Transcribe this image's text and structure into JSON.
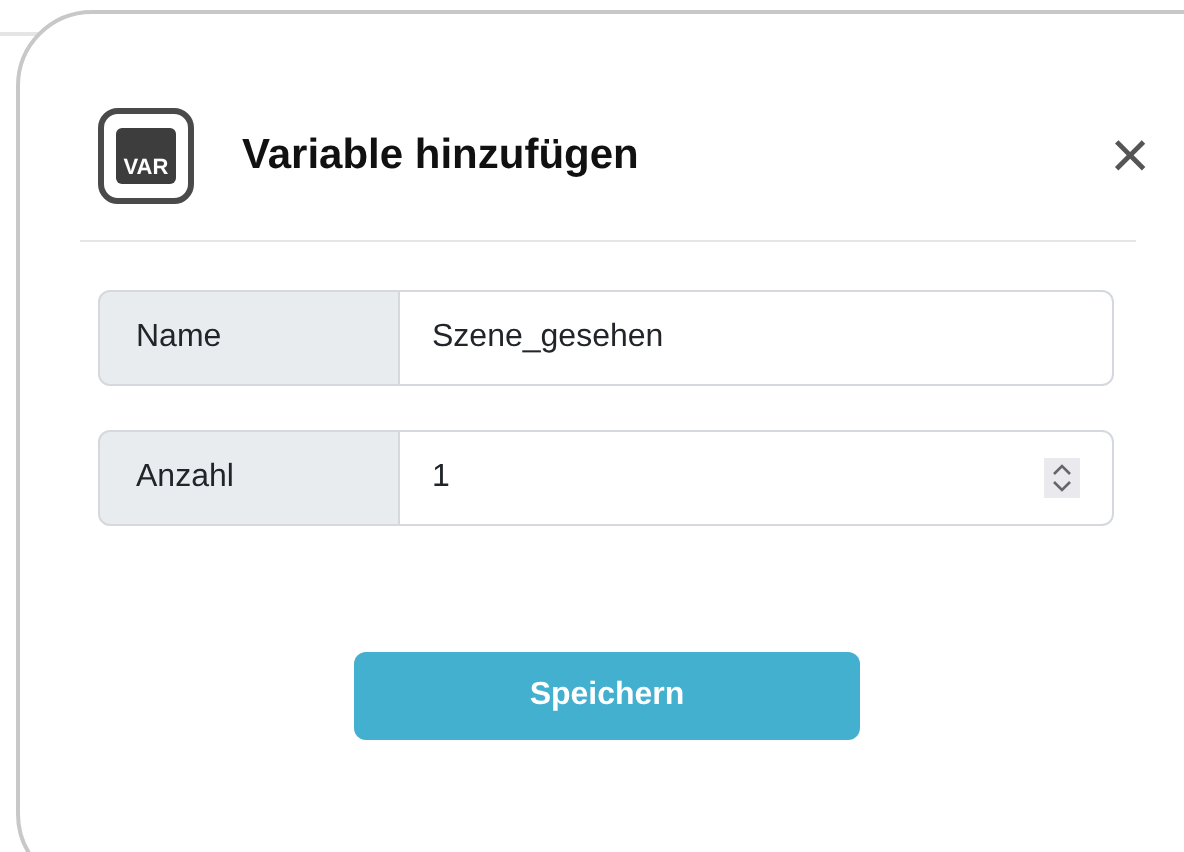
{
  "dialog": {
    "icon_label": "VAR",
    "title": "Variable hinzufügen",
    "close": "×"
  },
  "fields": [
    {
      "label": "Name",
      "value": "Szene_gesehen",
      "kind": "text"
    },
    {
      "label": "Anzahl",
      "value": "1",
      "kind": "number"
    }
  ],
  "buttons": [
    "Speichern"
  ]
}
